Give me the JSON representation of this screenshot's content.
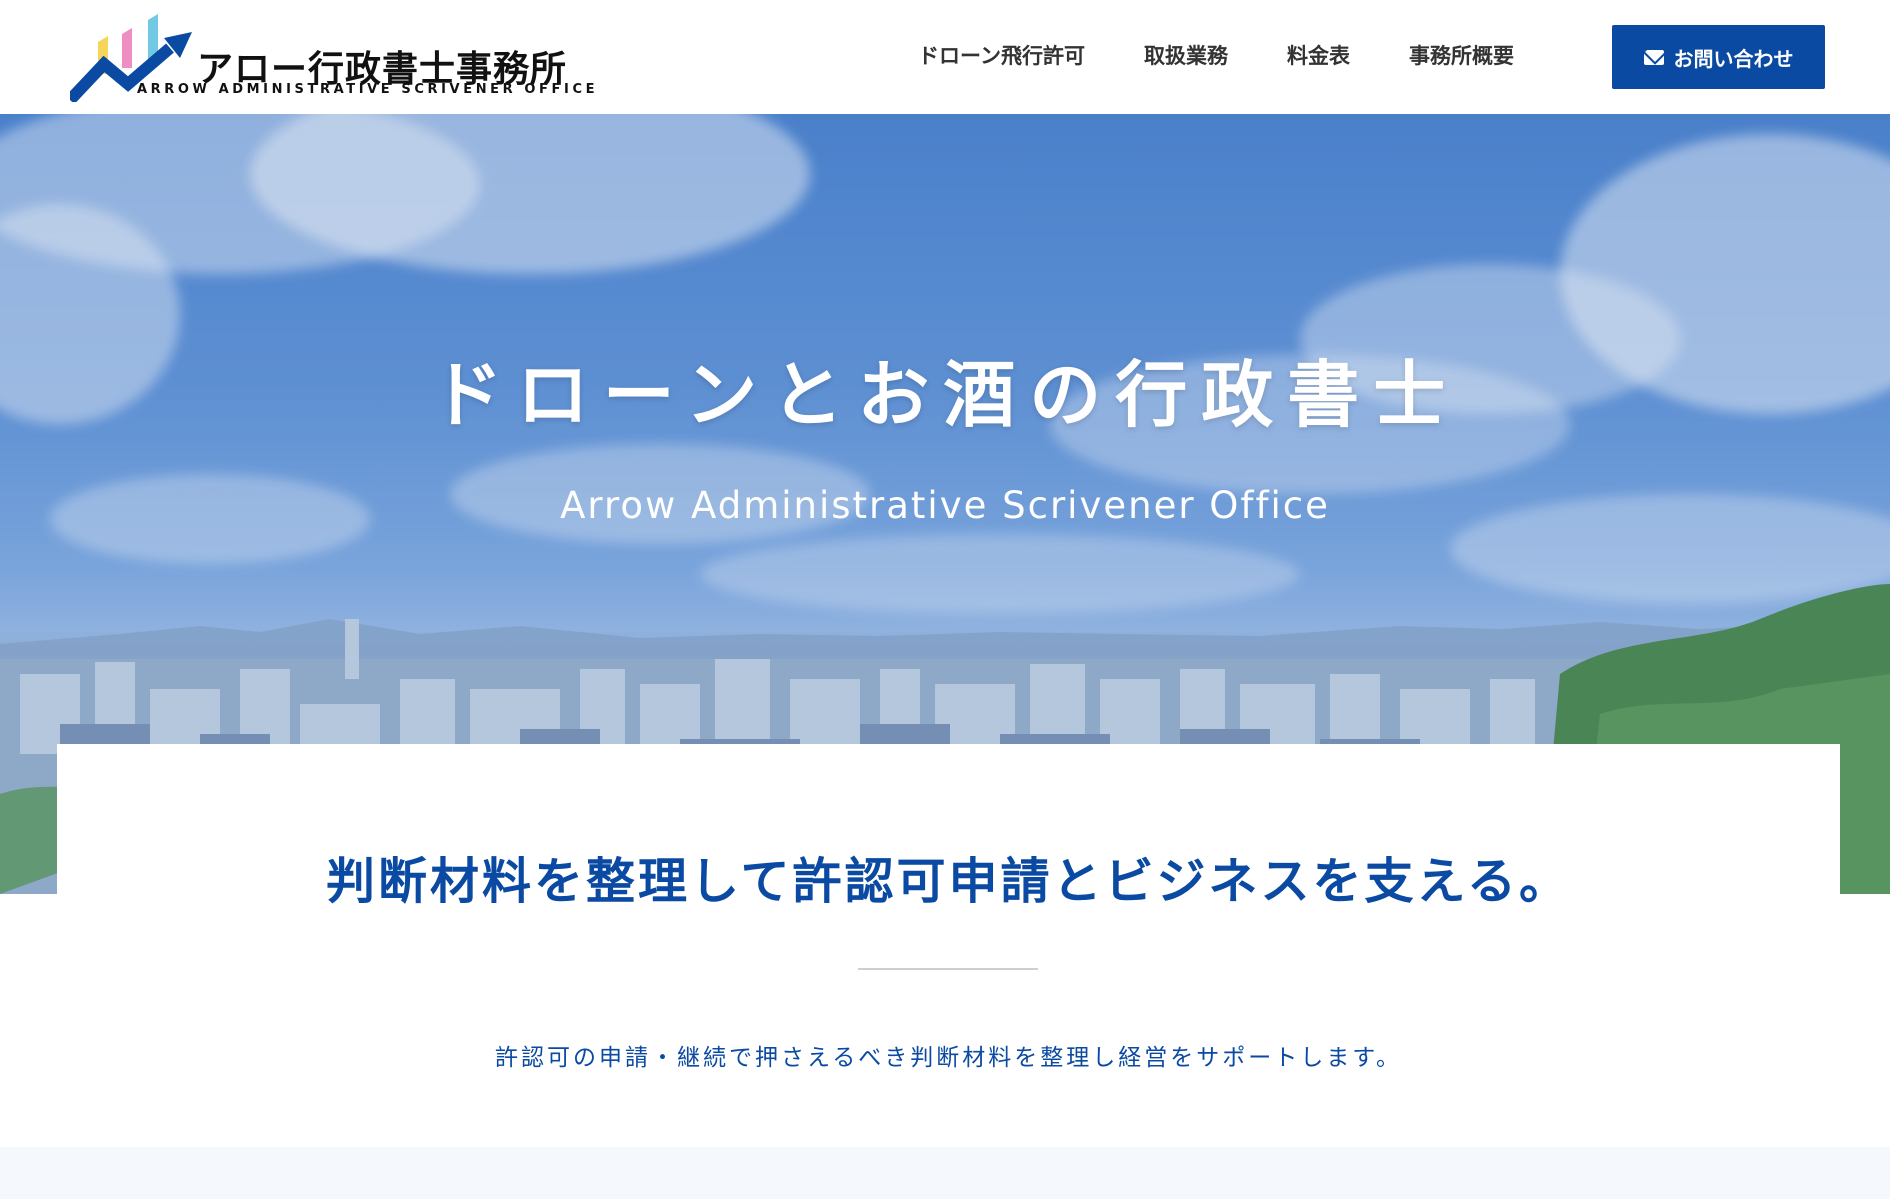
{
  "brand": {
    "title": "アロー行政書士事務所",
    "subtitle": "ARROW ADMINISTRATIVE SCRIVENER OFFICE"
  },
  "nav": {
    "items": [
      {
        "label": "ドローン飛行許可"
      },
      {
        "label": "取扱業務"
      },
      {
        "label": "料金表"
      },
      {
        "label": "事務所概要"
      }
    ],
    "contact_label": "お問い合わせ"
  },
  "hero": {
    "title": "ドローンとお酒の行政書士",
    "subtitle": "Arrow Administrative Scrivener Office"
  },
  "intro": {
    "heading": "判断材料を整理して許認可申請とビジネスを支える。",
    "text": "許認可の申請・継続で押さえるべき判断材料を整理し経営をサポートします。"
  },
  "colors": {
    "accent": "#0b4aa2",
    "sky": "#5b8fd4"
  },
  "icons": {
    "contact": "mail-icon",
    "logo_mark": "chart-arrow-logo"
  }
}
